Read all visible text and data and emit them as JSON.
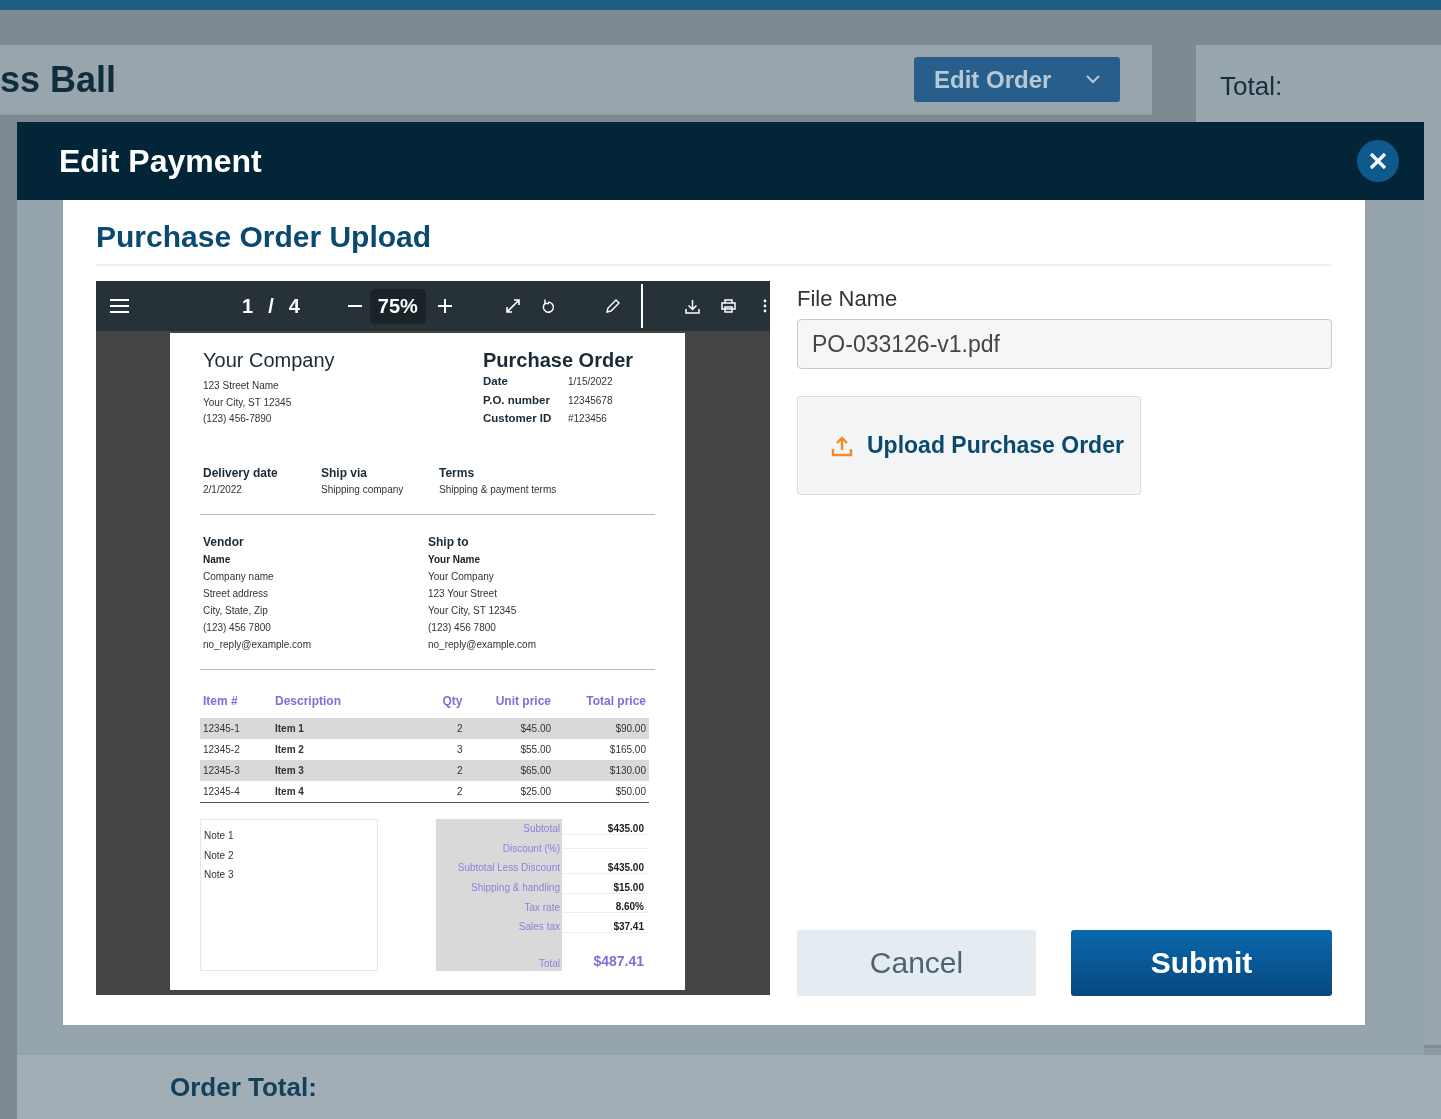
{
  "background": {
    "product_title": "ss Ball",
    "edit_order_button": "Edit Order",
    "total_label": "Total:",
    "order_total_label": "Order Total:"
  },
  "modal": {
    "title": "Edit Payment",
    "section_title": "Purchase Order Upload",
    "pdf_viewer": {
      "toolbar": {
        "page": "1",
        "separator": "/",
        "page_count": "4",
        "zoom": "75%"
      },
      "document": {
        "company": {
          "name": "Your Company",
          "lines": [
            "123 Street Name",
            "Your City, ST 12345",
            "(123) 456-7890"
          ]
        },
        "title": "Purchase Order",
        "meta": [
          {
            "label": "Date",
            "value": "1/15/2022"
          },
          {
            "label": "P.O. number",
            "value": "12345678"
          },
          {
            "label": "Customer ID",
            "value": "#123456"
          }
        ],
        "shipping_info": [
          {
            "label": "Delivery date",
            "value": "2/1/2022"
          },
          {
            "label": "Ship via",
            "value": "Shipping company"
          },
          {
            "label": "Terms",
            "value": "Shipping & payment terms"
          }
        ],
        "parties": [
          {
            "heading": "Vendor",
            "name": "Name",
            "lines": [
              "Company name",
              "Street address",
              "City, State, Zip",
              "(123) 456 7800",
              "no_reply@example.com"
            ]
          },
          {
            "heading": "Ship to",
            "name": "Your Name",
            "lines": [
              "Your Company",
              "123 Your Street",
              "Your City, ST 12345",
              "(123) 456 7800",
              "no_reply@example.com"
            ]
          }
        ],
        "items": {
          "columns": [
            "Item #",
            "Description",
            "Qty",
            "Unit price",
            "Total price"
          ],
          "rows": [
            [
              "12345-1",
              "Item 1",
              "2",
              "$45.00",
              "$90.00"
            ],
            [
              "12345-2",
              "Item 2",
              "3",
              "$55.00",
              "$165.00"
            ],
            [
              "12345-3",
              "Item 3",
              "2",
              "$65.00",
              "$130.00"
            ],
            [
              "12345-4",
              "Item 4",
              "2",
              "$25.00",
              "$50.00"
            ]
          ]
        },
        "notes": [
          "Note 1",
          "Note 2",
          "Note 3"
        ],
        "totals": [
          {
            "label": "Subtotal",
            "value": "$435.00"
          },
          {
            "label": "Discount (%)"
          },
          {
            "label": "Subtotal Less Discount",
            "value": "$435.00"
          },
          {
            "label": "Shipping & handling",
            "value": "$15.00"
          },
          {
            "label": "Tax rate",
            "value": "8.60%"
          },
          {
            "label": "Sales tax",
            "value": "$37.41"
          }
        ],
        "total": {
          "label": "Total",
          "value": "$487.41"
        }
      }
    },
    "file_name": {
      "label": "File Name",
      "value": "PO-033126-v1.pdf"
    },
    "upload_button": "Upload Purchase Order",
    "buttons": [
      {
        "label": "Cancel",
        "kind": "secondary"
      },
      {
        "label": "Submit",
        "kind": "primary"
      }
    ]
  }
}
